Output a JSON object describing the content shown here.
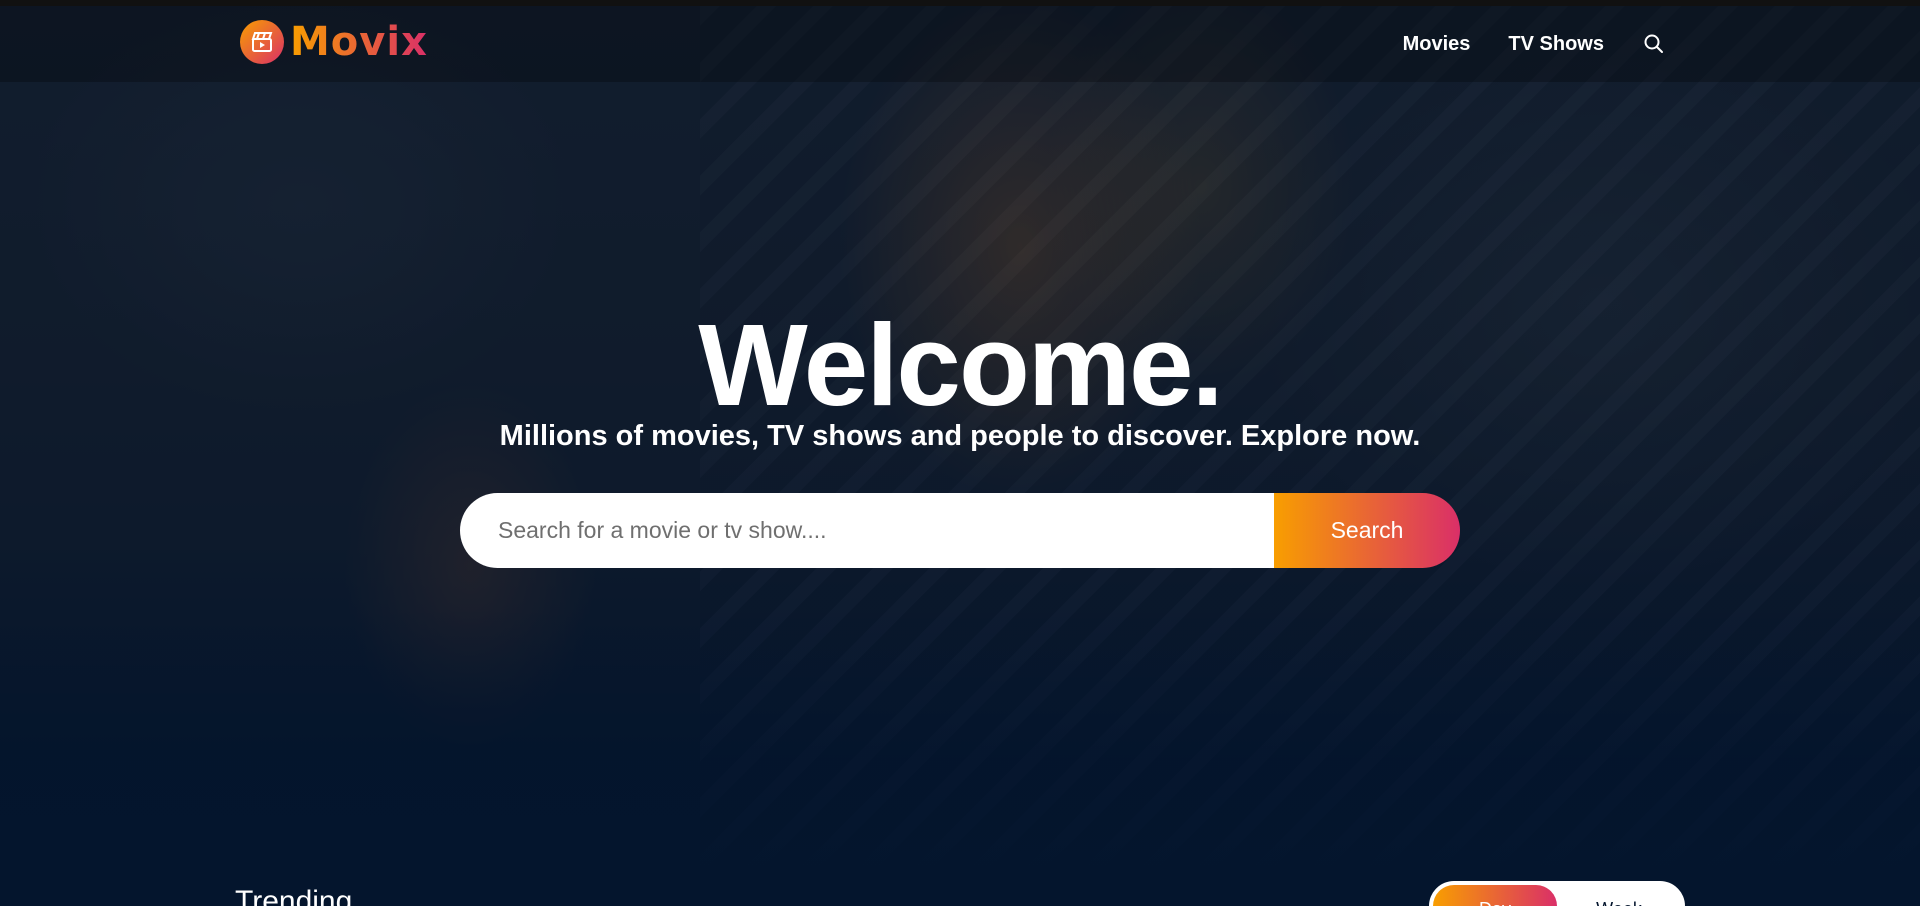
{
  "brand": {
    "name": "Movix"
  },
  "nav": {
    "items": [
      {
        "label": "Movies"
      },
      {
        "label": "TV Shows"
      }
    ]
  },
  "hero": {
    "title": "Welcome.",
    "subtitle": "Millions of movies, TV shows and people to discover. Explore now.",
    "search": {
      "placeholder": "Search for a movie or tv show....",
      "button_label": "Search"
    }
  },
  "trending": {
    "title": "Trending",
    "tabs": [
      {
        "label": "Day",
        "active": true
      },
      {
        "label": "Week",
        "active": false
      }
    ]
  },
  "colors": {
    "background": "#04152d",
    "accent_start": "#f89e00",
    "accent_end": "#da2f68"
  }
}
